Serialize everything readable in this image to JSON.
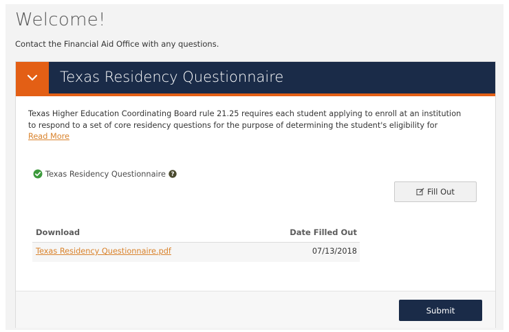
{
  "page": {
    "welcome_title": "Welcome!",
    "contact_text": "Contact the Financial Aid Office with any questions."
  },
  "questionnaire": {
    "title": "Texas Residency Questionnaire",
    "toggle_icon": "chevron-down-icon",
    "description_line1": "Texas Higher Education Coordinating Board rule 21.25 requires each student applying to enroll at an institution",
    "description_line2": "to respond to a set of core residency questions for the purpose of determining the student's eligibility for",
    "read_more_label": "Read More",
    "status_label": "Texas Residency Questionnaire",
    "status_icon": "check-circle-icon",
    "help_icon": "question-circle-icon",
    "fill_out_label": "Fill Out",
    "fill_out_icon": "edit-icon",
    "table": {
      "headers": [
        "Download",
        "Date Filled Out"
      ],
      "rows": [
        {
          "file": "Texas Residency Questionnaire.pdf",
          "date": "07/13/2018"
        }
      ]
    },
    "submit_label": "Submit"
  },
  "colors": {
    "accent_orange": "#e35f15",
    "header_navy": "#1a2b48",
    "link_orange": "#d9822b",
    "success_green": "#3c9a3c"
  }
}
